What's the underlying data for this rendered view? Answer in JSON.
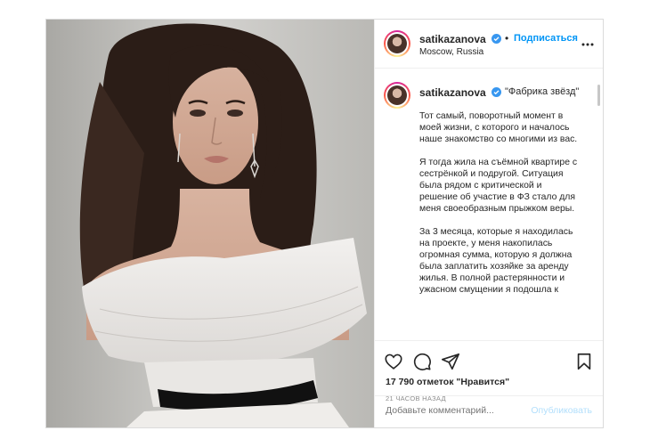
{
  "post": {
    "author": {
      "username": "satikazanova",
      "follow_label": "Подписаться",
      "location": "Moscow, Russia",
      "separator": "•"
    },
    "more_label": "•••",
    "caption": {
      "username": "satikazanova",
      "title": "\"Фабрика звёзд\"",
      "paragraphs": [
        "Тот самый, поворотный момент в моей жизни, с которого и началось наше знакомство со многими из вас.",
        "Я тогда жила на съёмной квартире с сестрёнкой и подругой. Ситуация была рядом с критической и решение об участие в ФЗ стало для меня своеобразным прыжком веры.",
        "За 3 месяца, которые я находилась на проекте, у меня накопилась огромная сумма, которую я должна была заплатить хозяйке за аренду жилья. В полной растерянности и ужасном смущении я подошла к"
      ]
    },
    "actions": {
      "like_icon": "heart-icon",
      "comment_icon": "comment-icon",
      "share_icon": "share-icon",
      "save_icon": "bookmark-icon"
    },
    "likes_text": "17 790 отметок \"Нравится\"",
    "time_text": "21 ЧАСОВ НАЗАД",
    "comment_placeholder": "Добавьте комментарий...",
    "publish_label": "Опубликовать",
    "colors": {
      "accent": "#0095f6",
      "verified": "#3897f0",
      "publish_disabled": "#b2dffc",
      "muted": "#8e8e8e"
    }
  }
}
